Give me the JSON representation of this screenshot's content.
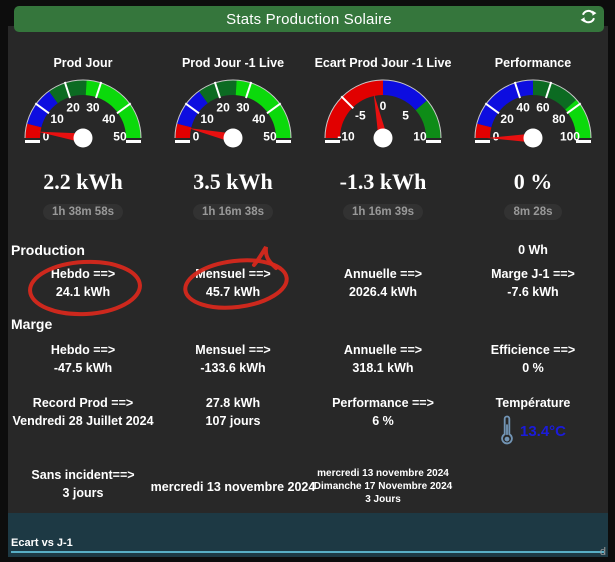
{
  "header": {
    "title": "Stats Production Solaire",
    "refresh_icon": "refresh-icon"
  },
  "colors": {
    "page_bg": "#0d0d0d",
    "card_bg": "#282828",
    "header_green": "#35763c",
    "annotation_red": "#d6281c",
    "temperature_blue": "#1b1bdb",
    "chart_panel_teal": "#1d3944",
    "chart_line_blue": "#58aec5",
    "gauge_needle_red": "#e81010"
  },
  "gauges": [
    {
      "title": "Prod Jour",
      "value_label": "2.2 kWh",
      "elapsed": "1h 38m 58s",
      "min": 0,
      "max": 50,
      "value": 2.2,
      "tick_labels": [
        0,
        10,
        20,
        30,
        40,
        50
      ],
      "tick_lines": [
        10,
        20,
        30,
        40
      ],
      "segments": [
        [
          0,
          4,
          "#e10000"
        ],
        [
          4,
          15,
          "#0d0de0"
        ],
        [
          15,
          26,
          "#0c6b22"
        ],
        [
          26,
          50,
          "#0bd90b"
        ]
      ]
    },
    {
      "title": "Prod Jour -1 Live",
      "value_label": "3.5 kWh",
      "elapsed": "1h 16m 38s",
      "min": 0,
      "max": 50,
      "value": 3.5,
      "tick_labels": [
        0,
        10,
        20,
        30,
        40,
        50
      ],
      "tick_lines": [
        10,
        20,
        30,
        40
      ],
      "segments": [
        [
          0,
          4,
          "#e10000"
        ],
        [
          4,
          15,
          "#0d0de0"
        ],
        [
          15,
          26,
          "#0c6b22"
        ],
        [
          26,
          50,
          "#0bd90b"
        ]
      ]
    },
    {
      "title": "Ecart Prod Jour -1 Live",
      "value_label": "-1.3 kWh",
      "elapsed": "1h 16m 39s",
      "min": -10,
      "max": 10,
      "value": -1.3,
      "tick_labels": [
        -10,
        -5,
        0,
        5,
        10
      ],
      "tick_lines": [
        -5
      ],
      "segments": [
        [
          -10,
          0,
          "#e10000"
        ],
        [
          0,
          5.5,
          "#0d0de0"
        ],
        [
          5.5,
          10,
          "#0e8c17"
        ]
      ]
    },
    {
      "title": "Performance",
      "value_label": "0 %",
      "elapsed": "8m 28s",
      "min": 0,
      "max": 100,
      "value": 0,
      "tick_labels": [
        0,
        20,
        40,
        60,
        80,
        100
      ],
      "tick_lines": [
        20,
        40,
        60,
        80
      ],
      "segments": [
        [
          0,
          8,
          "#e10000"
        ],
        [
          8,
          50,
          "#0d0de0"
        ],
        [
          50,
          77,
          "#0c6b22"
        ],
        [
          77,
          100,
          "#0bd90b"
        ]
      ]
    }
  ],
  "production": {
    "section_label": "Production",
    "top_right_value": "0 Wh",
    "items": [
      {
        "label": "Hebdo ==>",
        "value": "24.1 kWh"
      },
      {
        "label": "Mensuel ==>",
        "value": "45.7 kWh"
      },
      {
        "label": "Annuelle ==>",
        "value": "2026.4 kWh"
      },
      {
        "label": "Marge J-1 ==>",
        "value": "-7.6 kWh"
      }
    ]
  },
  "marge": {
    "section_label": "Marge",
    "items": [
      {
        "label": "Hebdo ==>",
        "value": "-47.5 kWh"
      },
      {
        "label": "Mensuel ==>",
        "value": "-133.6 kWh"
      },
      {
        "label": "Annuelle ==>",
        "value": "318.1 kWh"
      },
      {
        "label": "Efficience ==>",
        "value": "0 %"
      }
    ]
  },
  "records": {
    "record_label": "Record Prod ==>",
    "record_date": "Vendredi 28 Juillet 2024",
    "record_value": "27.8 kWh",
    "record_days": "107 jours",
    "performance_label": "Performance ==>",
    "performance_value": "6 %",
    "temperature_label": "Température",
    "temperature_value": "13.4°C",
    "thermometer_icon": "thermometer-icon"
  },
  "incidents": {
    "label": "Sans incident==>",
    "value": "3 jours",
    "current_date": "mercredi 13 novembre 2024",
    "range_line1": "mercredi 13 novembre 2024",
    "range_line2": "Dimanche 17 Novembre 2024",
    "range_line3": "3 Jours"
  },
  "bottom_chart": {
    "title": "Ecart vs J-1",
    "stray_char": "d"
  }
}
